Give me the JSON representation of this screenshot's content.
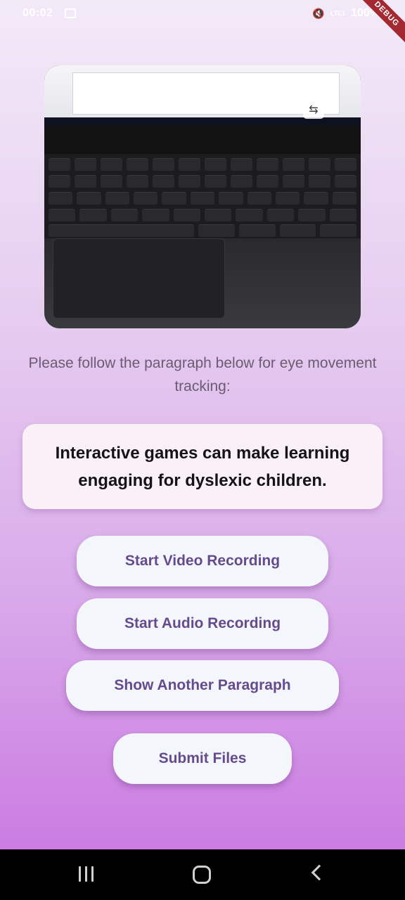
{
  "status_bar": {
    "time": "00:02",
    "battery": "100%",
    "signal": "LTE1"
  },
  "debug_ribbon": "DEBUG",
  "instruction": "Please follow the paragraph below for eye movement tracking:",
  "paragraph": "Interactive games can make learning engaging for dyslexic children.",
  "buttons": {
    "start_video": "Start Video Recording",
    "start_audio": "Start Audio Recording",
    "show_another": "Show Another Paragraph",
    "submit": "Submit Files"
  },
  "colors": {
    "button_bg": "#f3f7fb",
    "button_text": "#654a8d",
    "card_bg": "#faf0f8",
    "gradient_top": "#f3eaf8",
    "gradient_bottom": "#c873e0"
  },
  "icons": {
    "camera_switch": "flip-camera-icon",
    "nav_recent": "recent-apps-icon",
    "nav_home": "home-icon",
    "nav_back": "back-icon"
  }
}
